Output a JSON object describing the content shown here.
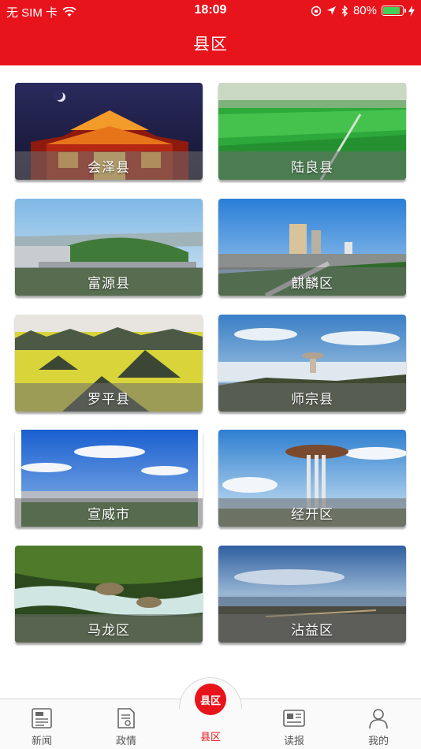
{
  "status_bar": {
    "carrier": "无 SIM 卡",
    "time": "18:09",
    "battery": "80%"
  },
  "header": {
    "title": "县区"
  },
  "counties": [
    {
      "name": "会泽县"
    },
    {
      "name": "陆良县"
    },
    {
      "name": "富源县"
    },
    {
      "name": "麒麟区"
    },
    {
      "name": "罗平县"
    },
    {
      "name": "师宗县"
    },
    {
      "name": "宣威市"
    },
    {
      "name": "经开区"
    },
    {
      "name": "马龙区"
    },
    {
      "name": "沾益区"
    }
  ],
  "tabbar": {
    "tabs": [
      {
        "label": "新闻",
        "icon": "newspaper-icon"
      },
      {
        "label": "政情",
        "icon": "document-icon"
      },
      {
        "label": "县区",
        "icon": "county-logo-icon",
        "badge_text": "县区"
      },
      {
        "label": "读报",
        "icon": "reader-icon"
      },
      {
        "label": "我的",
        "icon": "user-icon"
      }
    ],
    "active_index": 2
  },
  "colors": {
    "brand_red": "#e8141c"
  }
}
